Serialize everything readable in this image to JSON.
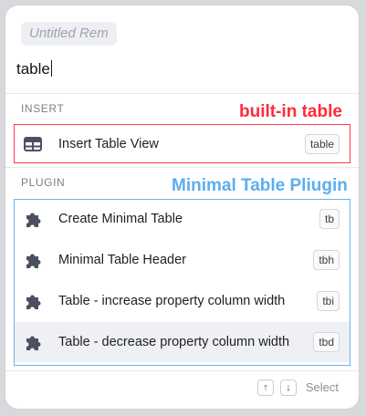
{
  "rem_title": "Untitled Rem",
  "query": "table",
  "sections": {
    "insert": "INSERT",
    "plugin": "PLUGIN"
  },
  "annotations": {
    "builtin": "built-in table",
    "plugin": "Minimal Table Pliugin"
  },
  "insert_items": [
    {
      "label": "Insert Table View",
      "shortcut": "table",
      "icon": "table-view-icon"
    }
  ],
  "plugin_items": [
    {
      "label": "Create Minimal Table",
      "shortcut": "tb",
      "icon": "puzzle-icon"
    },
    {
      "label": "Minimal Table Header",
      "shortcut": "tbh",
      "icon": "puzzle-icon"
    },
    {
      "label": "Table - increase property column width",
      "shortcut": "tbi",
      "icon": "puzzle-icon"
    },
    {
      "label": "Table - decrease property column width",
      "shortcut": "tbd",
      "icon": "puzzle-icon"
    }
  ],
  "footer": {
    "up": "↑",
    "down": "↓",
    "select": "Select"
  },
  "colors": {
    "annotation_red": "#ff2b3d",
    "annotation_blue": "#5aaef0",
    "icon": "#4b5060"
  }
}
